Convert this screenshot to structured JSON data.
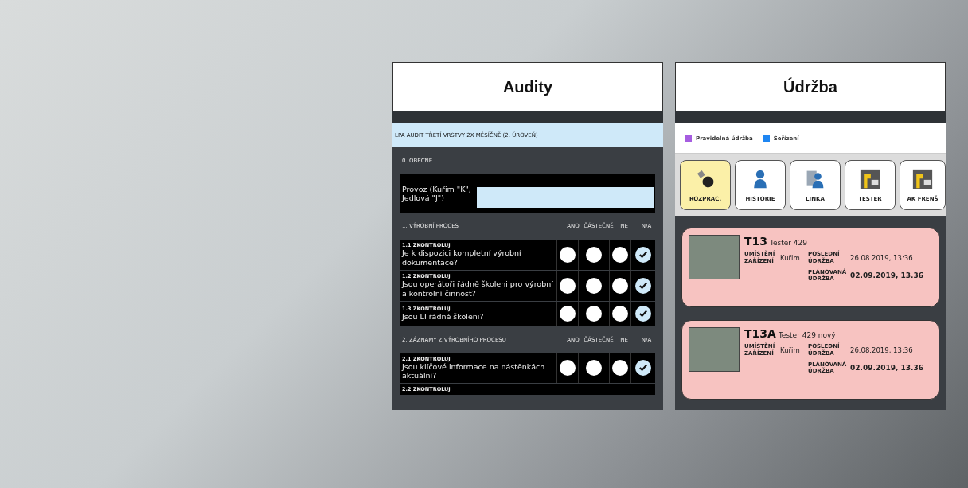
{
  "audits": {
    "title": "Audity",
    "audit_name": "LPA AUDIT TŘETÍ VRSTVY 2X MĚSÍČNĚ (2. ÚROVEŇ)",
    "general": {
      "heading": "0. OBECNÉ",
      "field_label": "Provoz (Kuřim \"K\", Jedlová \"J\")"
    },
    "sections": [
      {
        "heading": "1. VÝROBNÍ PROCES",
        "columns": [
          "ANO",
          "ČÁSTEČNĚ",
          "NE",
          "N/A"
        ],
        "questions": [
          {
            "code": "1.1 ZKONTROLUJ",
            "text": "Je k dispozici kompletní výrobní dokumentace?",
            "choices": [
              {
                "selected": false
              },
              {
                "selected": false
              },
              {
                "selected": false
              },
              {
                "selected": true
              }
            ]
          },
          {
            "code": "1.2 ZKONTROLUJ",
            "text": "Jsou operátoři řádně školeni pro výrobní a kontrolní činnost?",
            "choices": [
              {
                "selected": false
              },
              {
                "selected": false
              },
              {
                "selected": false
              },
              {
                "selected": true
              }
            ]
          },
          {
            "code": "1.3 ZKONTROLUJ",
            "text": "Jsou LI řádně školeni?",
            "choices": [
              {
                "selected": false
              },
              {
                "selected": false
              },
              {
                "selected": false
              },
              {
                "selected": true
              }
            ]
          }
        ]
      },
      {
        "heading": "2. ZÁZNAMY Z VÝROBNÍHO PROCESU",
        "columns": [
          "ANO",
          "ČÁSTEČNĚ",
          "NE",
          "N/A"
        ],
        "questions": [
          {
            "code": "2.1 ZKONTROLUJ",
            "text": "Jsou klíčové informace na nástěnkách aktuální?",
            "choices": [
              {
                "selected": false
              },
              {
                "selected": false
              },
              {
                "selected": false
              },
              {
                "selected": true
              }
            ]
          },
          {
            "code": "2.2 ZKONTROLUJ"
          }
        ]
      }
    ]
  },
  "maintenance": {
    "title": "Údržba",
    "legend": [
      {
        "label": "Pravidelná údržba",
        "color": "#a65de0"
      },
      {
        "label": "Seřízení",
        "color": "#1f86f2"
      }
    ],
    "tabs": [
      {
        "label": "ROZPRAC.",
        "kind": "tool",
        "selected": true
      },
      {
        "label": "HISTORIE",
        "kind": "person",
        "selected": false
      },
      {
        "label": "LINKA",
        "kind": "line",
        "selected": false
      },
      {
        "label": "TESTER",
        "kind": "machine",
        "selected": false
      },
      {
        "label": "AK FRENŠ",
        "kind": "machine",
        "selected": false
      }
    ],
    "cards": [
      {
        "code": "T13",
        "name": "Tester 429",
        "location_label": "UMÍSTĚNÍ ZAŘÍZENÍ",
        "location": "Kuřim",
        "last_label": "POSLEDNÍ ÚDRŽBA",
        "last": "26.08.2019, 13:36",
        "planned_label": "PLÁNOVANÁ ÚDRŽBA",
        "planned": "02.09.2019, 13.36"
      },
      {
        "code": "T13A",
        "name": "Tester 429 nový",
        "location_label": "UMÍSTĚNÍ ZAŘÍZENÍ",
        "location": "Kuřim",
        "last_label": "POSLEDNÍ ÚDRŽBA",
        "last": "26.08.2019, 13:36",
        "planned_label": "PLÁNOVANÁ ÚDRŽBA",
        "planned": "02.09.2019, 13.36"
      }
    ]
  }
}
